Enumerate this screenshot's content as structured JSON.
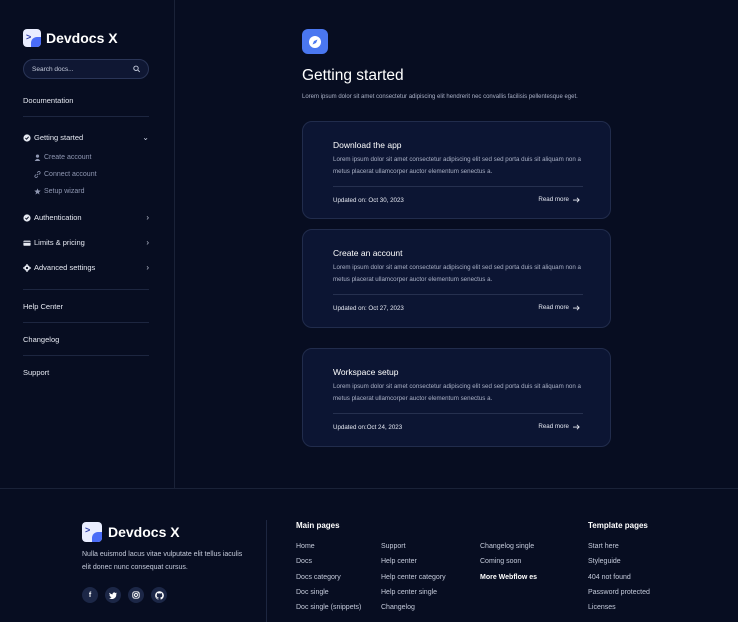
{
  "brand": {
    "name": "Devdocs X"
  },
  "search": {
    "placeholder": "Search docs..."
  },
  "sidebar": {
    "documentation": "Documentation",
    "groups": [
      {
        "label": "Getting started",
        "icon": "check-circle-icon",
        "expanded": true,
        "children": [
          {
            "label": "Create account",
            "icon": "user-icon"
          },
          {
            "label": "Connect account",
            "icon": "link-icon"
          },
          {
            "label": "Setup wizard",
            "icon": "star-icon"
          }
        ]
      },
      {
        "label": "Authentication",
        "icon": "check-badge-icon"
      },
      {
        "label": "Limits & pricing",
        "icon": "card-icon"
      },
      {
        "label": "Advanced settings",
        "icon": "gear-icon"
      }
    ],
    "links": [
      "Help Center",
      "Changelog",
      "Support"
    ]
  },
  "main": {
    "icon": "compass-icon",
    "title": "Getting started",
    "subtitle": "Lorem ipsum dolor sit amet consectetur adipiscing elit hendrerit nec convallis facilisis pellentesque eget.",
    "cards": [
      {
        "title": "Download the app",
        "text": "Lorem ipsum dolor sit amet consectetur adipiscing elit sed sed porta duis sit aliquam non a metus placerat ullamcorper auctor elementum senectus a.",
        "updated": "Updated on: Oct 30, 2023",
        "more": "Read more"
      },
      {
        "title": "Create an account",
        "text": "Lorem ipsum dolor sit amet consectetur adipiscing elit sed sed porta duis sit aliquam non a metus placerat ullamcorper auctor elementum senectus a.",
        "updated": "Updated on: Oct 27, 2023",
        "more": "Read more"
      },
      {
        "title": "Workspace setup",
        "text": "Lorem ipsum dolor sit amet consectetur adipiscing elit sed sed porta duis sit aliquam non a metus placerat ullamcorper auctor elementum senectus a.",
        "updated": "Updated on:Oct 24, 2023",
        "more": "Read more"
      }
    ]
  },
  "footer": {
    "brand": "Devdocs X",
    "description": "Nulla euismod lacus vitae vulputate elit tellus iaculis elit donec nunc consequat cursus.",
    "socials": [
      "facebook-icon",
      "twitter-icon",
      "instagram-icon",
      "github-icon"
    ],
    "main_pages_title": "Main pages",
    "main_col1": [
      "Home",
      "Docs",
      "Docs category",
      "Doc single",
      "Doc single (snippets)"
    ],
    "main_col2": [
      "Support",
      "Help center",
      "Help center category",
      "Help center single",
      "Changelog"
    ],
    "main_col3": [
      "Changelog single",
      "Coming soon",
      "More Webflow es"
    ],
    "template_pages_title": "Template pages",
    "template_col": [
      "Start here",
      "Styleguide",
      "404 not found",
      "Password protected",
      "Licenses"
    ]
  }
}
